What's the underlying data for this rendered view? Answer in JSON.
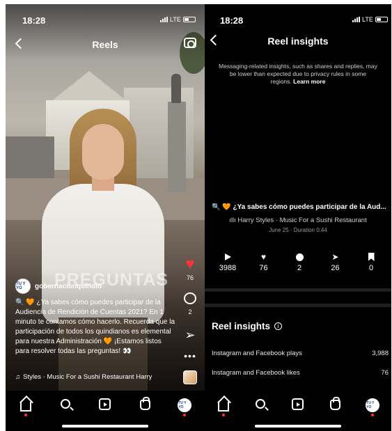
{
  "status_bar": {
    "time": "18:28",
    "network": "LTE"
  },
  "reel": {
    "header_title": "Reels",
    "video_overlay_text": "PREGUNTAS",
    "account_name": "gobernacionquindio",
    "avatar_text": "TU Y YO",
    "caption": "🔍 🧡 ¿Ya sabes cómo puedes participar de la Audiencia de Rendición de Cuentas 2021? En 1 minuto te contamos cómo hacerlo. Recuerda que la participación de todos los quindianos es elemental para nuestra Administración 🧡 ¡Estamos listos para resolver todas las preguntas! 👀",
    "music_text": "Styles · Music For a Sushi Restaurant   Harry",
    "like_count": "76",
    "comment_count": "2"
  },
  "insights": {
    "header_title": "Reel insights",
    "notice_text": "Messaging-related insights, such as shares and replies, may be lower than expected due to privacy rules in some regions.",
    "learn_more": "Learn more",
    "reel_title": "🔍 🧡 ¿Ya sabes cómo puedes participar de la Aud...",
    "audio_text": "Harry Styles · Music For a Sushi Restaurant",
    "date_text": "June 25 · Duration 0:44",
    "metrics": [
      {
        "icon": "play-icon",
        "value": "3988"
      },
      {
        "icon": "heart-icon",
        "value": "76"
      },
      {
        "icon": "comment-icon",
        "value": "2"
      },
      {
        "icon": "share-icon",
        "value": "26"
      },
      {
        "icon": "bookmark-icon",
        "value": "0"
      }
    ],
    "section_title": "Reel insights",
    "rows": [
      {
        "label": "Instagram and Facebook plays",
        "value": "3,988"
      },
      {
        "label": "Instagram and Facebook likes",
        "value": "76"
      }
    ]
  },
  "colors": {
    "like_red": "#ff3040",
    "background": "#000000"
  }
}
